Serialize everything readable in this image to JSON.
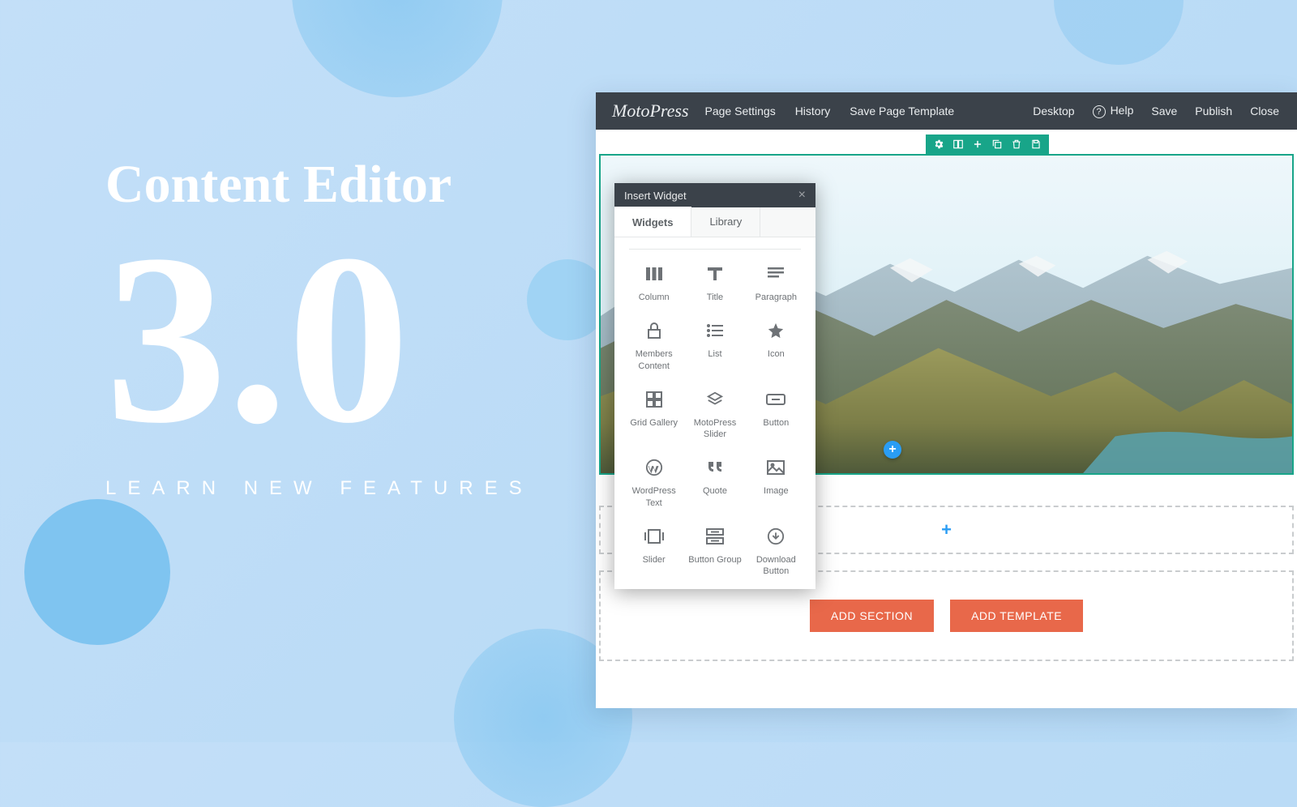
{
  "hero": {
    "title": "Content Editor",
    "version": "3.0",
    "tagline": "LEARN NEW FEATURES"
  },
  "toolbar": {
    "brand": "MotoPress",
    "left": [
      "Page Settings",
      "History",
      "Save Page Template"
    ],
    "right": [
      "Desktop",
      "Help",
      "Save",
      "Publish",
      "Close"
    ]
  },
  "modal": {
    "title": "Insert Widget",
    "tabs": {
      "widgets": "Widgets",
      "library": "Library"
    },
    "widgets": [
      {
        "id": "column",
        "label": "Column"
      },
      {
        "id": "title",
        "label": "Title"
      },
      {
        "id": "paragraph",
        "label": "Paragraph"
      },
      {
        "id": "members",
        "label": "Members Content"
      },
      {
        "id": "list",
        "label": "List"
      },
      {
        "id": "icon",
        "label": "Icon"
      },
      {
        "id": "gallery",
        "label": "Grid Gallery"
      },
      {
        "id": "mpslider",
        "label": "MotoPress Slider"
      },
      {
        "id": "button",
        "label": "Button"
      },
      {
        "id": "wptext",
        "label": "WordPress Text"
      },
      {
        "id": "quote",
        "label": "Quote"
      },
      {
        "id": "image",
        "label": "Image"
      },
      {
        "id": "slider",
        "label": "Slider"
      },
      {
        "id": "btngroup",
        "label": "Button Group"
      },
      {
        "id": "download",
        "label": "Download Button"
      }
    ]
  },
  "buttons": {
    "add_section": "ADD SECTION",
    "add_template": "ADD TEMPLATE"
  }
}
